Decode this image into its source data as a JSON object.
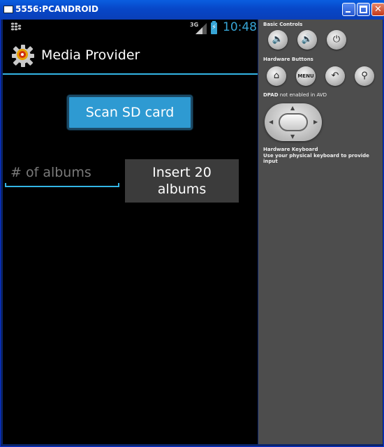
{
  "window": {
    "title": "5556:PCANDROID"
  },
  "status_bar": {
    "network": "3G",
    "time": "10:48"
  },
  "action_bar": {
    "app_title": "Media Provider",
    "app_icon": "gear-icon"
  },
  "main": {
    "scan_button": "Scan SD card",
    "albums_input": {
      "placeholder": "# of albums",
      "value": ""
    },
    "insert_button": "Insert 20 albums"
  },
  "panel": {
    "basic_controls_label": "Basic Controls",
    "hardware_buttons_label": "Hardware Buttons",
    "menu_label": "MENU",
    "dpad_label": "DPAD",
    "dpad_note": " not enabled in AVD",
    "keyboard_label": "Hardware Keyboard",
    "keyboard_note": "Use your physical keyboard to provide input"
  },
  "colors": {
    "accent": "#33b5e5",
    "titlebar": "#0a5ee0",
    "panel": "#4d4d4d"
  }
}
